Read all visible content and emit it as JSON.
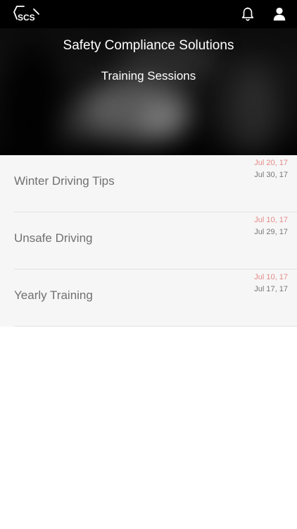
{
  "header": {
    "logo_text": "SCS",
    "icons": [
      "bell-icon",
      "user-icon"
    ]
  },
  "hero": {
    "title": "Safety Compliance Solutions",
    "subtitle": "Training Sessions"
  },
  "sessions": [
    {
      "name": "Winter Driving Tips",
      "date1": "Jul 20, 17",
      "date2": "Jul 30, 17"
    },
    {
      "name": "Unsafe Driving",
      "date1": "Jul 10, 17",
      "date2": "Jul 29, 17"
    },
    {
      "name": "Yearly Training",
      "date1": "Jul 10, 17",
      "date2": "Jul 17, 17"
    }
  ],
  "colors": {
    "topbar": "#000000",
    "row_background": "#f6f6f6",
    "date_highlight": "#e58a8a",
    "date_secondary": "#777777"
  }
}
